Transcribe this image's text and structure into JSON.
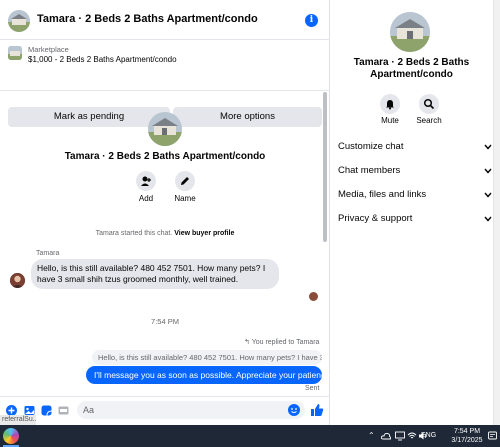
{
  "header": {
    "title": "Tamara · 2 Beds 2 Baths Apartment/condo",
    "info_icon": "info-icon"
  },
  "listing": {
    "label": "Marketplace",
    "description": "$1,000 - 2 Beds 2 Baths Apartment/condo",
    "mark_pending_label": "Mark as pending",
    "more_options_label": "More options"
  },
  "chat_intro": {
    "title": "Tamara · 2 Beds 2 Baths Apartment/condo",
    "add_label": "Add",
    "name_label": "Name",
    "started_text": "Tamara started this chat.",
    "view_profile_label": "View buyer profile"
  },
  "messages": {
    "sender_name": "Tamara",
    "incoming_text": "Hello, is this still available? 480 452 7501.  How many pets? I have 3 small shih tzus  groomed monthly,  well trained.",
    "timestamp": "7:54 PM",
    "replied_label": "You replied to Tamara",
    "quoted_text": "Hello, is this still available? 480 452 7501.  How many pets? I have 3 s...",
    "outgoing_text": "I'll message you as soon as possible. Appreciate your patience",
    "sent_status": "Sent"
  },
  "composer": {
    "placeholder": "Aa",
    "referral_text": "referralSu..."
  },
  "details_panel": {
    "title": "Tamara · 2 Beds 2 Baths Apartment/condo",
    "mute_label": "Mute",
    "search_label": "Search",
    "sections": [
      "Customize chat",
      "Chat members",
      "Media, files and links",
      "Privacy & support"
    ]
  },
  "taskbar": {
    "language": "ENG",
    "time": "7:54 PM",
    "date": "3/17/2025"
  },
  "colors": {
    "accent": "#0866ff",
    "bubble_in": "#e4e6eb",
    "taskbar": "#1f2837"
  }
}
